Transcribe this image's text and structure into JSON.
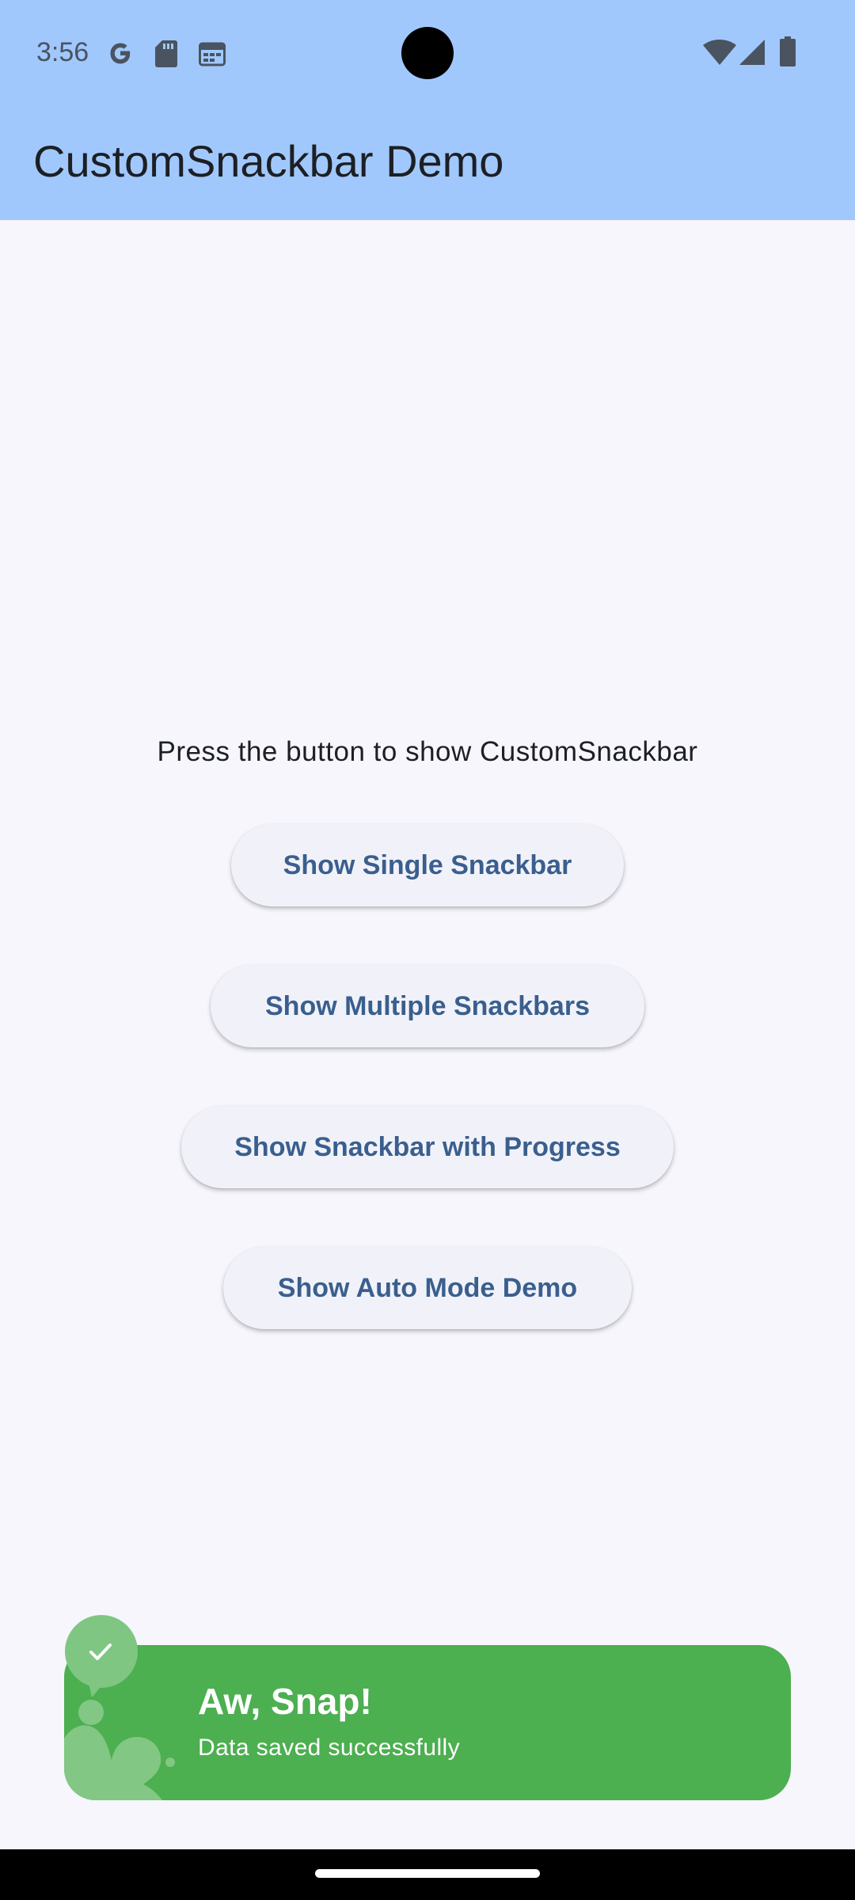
{
  "status_bar": {
    "time": "3:56",
    "left_icons": [
      "google-icon",
      "sd-card-icon",
      "calendar-icon"
    ],
    "right_icons": [
      "wifi-icon",
      "signal-icon",
      "battery-icon"
    ]
  },
  "app_bar": {
    "title": "CustomSnackbar Demo"
  },
  "main": {
    "prompt": "Press the button to show CustomSnackbar",
    "buttons": [
      {
        "label": "Show Single Snackbar"
      },
      {
        "label": "Show Multiple Snackbars"
      },
      {
        "label": "Show Snackbar with Progress"
      },
      {
        "label": "Show Auto Mode Demo"
      }
    ]
  },
  "snackbar": {
    "title": "Aw, Snap!",
    "message": "Data saved successfully",
    "icon": "check-icon",
    "color": "#4caf50"
  },
  "colors": {
    "app_bar": "#a1c8fc",
    "background": "#f6f6fc",
    "button_text": "#3a5f8e",
    "snackbar": "#4caf50"
  }
}
